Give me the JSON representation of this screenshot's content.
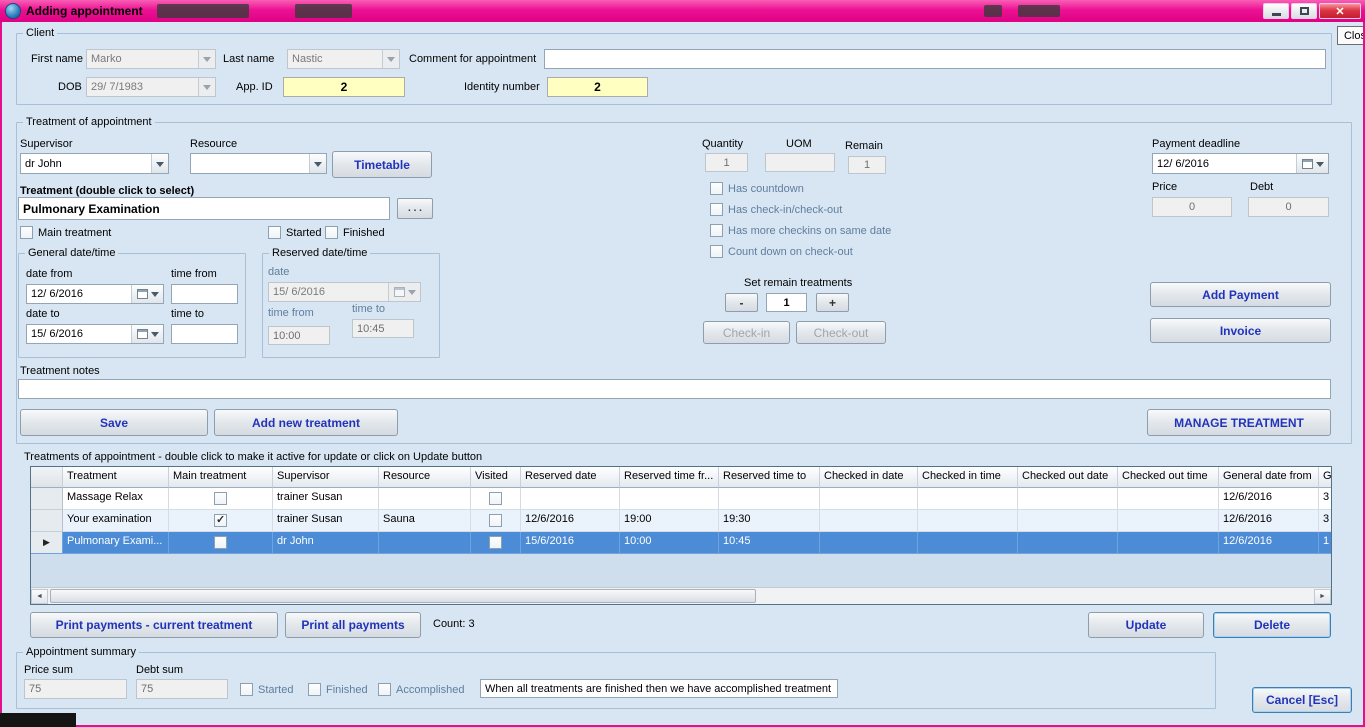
{
  "window": {
    "title": "Adding appointment",
    "close_button": "Close"
  },
  "client": {
    "label": "Client",
    "first_name": {
      "label": "First name",
      "value": "Marko"
    },
    "last_name": {
      "label": "Last name",
      "value": "Nastic"
    },
    "comment": {
      "label": "Comment for appointment",
      "value": ""
    },
    "dob": {
      "label": "DOB",
      "value": "29/ 7/1983"
    },
    "app_id": {
      "label": "App. ID",
      "value": "2"
    },
    "identity": {
      "label": "Identity number",
      "value": "2"
    }
  },
  "treatment": {
    "label": "Treatment of appointment",
    "supervisor": {
      "label": "Supervisor",
      "value": "dr John"
    },
    "resource": {
      "label": "Resource",
      "value": ""
    },
    "timetable": "Timetable",
    "select_label": "Treatment (double click to select)",
    "name": "Pulmonary Examination",
    "browse": ". . .",
    "main_cb": "Main treatment",
    "started_cb": "Started",
    "finished_cb": "Finished",
    "general": {
      "label": "General date/time",
      "date_from": {
        "label": "date from",
        "value": "12/ 6/2016"
      },
      "time_from": {
        "label": "time from",
        "value": ""
      },
      "date_to": {
        "label": "date to",
        "value": "15/ 6/2016"
      },
      "time_to": {
        "label": "time to",
        "value": ""
      }
    },
    "reserved": {
      "label": "Reserved date/time",
      "date": {
        "label": "date",
        "value": "15/ 6/2016"
      },
      "time_from": {
        "label": "time from",
        "value": "10:00"
      },
      "time_to": {
        "label": "time to",
        "value": "10:45"
      }
    },
    "quantity": {
      "label": "Quantity",
      "value": "1"
    },
    "uom": {
      "label": "UOM",
      "value": ""
    },
    "remain": {
      "label": "Remain",
      "value": "1"
    },
    "cbs": {
      "countdown": "Has countdown",
      "checkin": "Has check-in/check-out",
      "more": "Has more checkins on same date",
      "countdown_checkout": "Count down on check-out"
    },
    "set_remain": {
      "label": "Set remain treatments",
      "minus": "-",
      "value": "1",
      "plus": "+"
    },
    "checkin": "Check-in",
    "checkout": "Check-out",
    "payment_deadline": {
      "label": "Payment deadline",
      "value": "12/ 6/2016"
    },
    "price": {
      "label": "Price",
      "value": "0"
    },
    "debt": {
      "label": "Debt",
      "value": "0"
    },
    "add_payment": "Add Payment",
    "invoice": "Invoice",
    "notes": {
      "label": "Treatment notes",
      "value": ""
    },
    "save": "Save",
    "add_new": "Add new treatment",
    "manage": "MANAGE TREATMENT"
  },
  "grid": {
    "caption": "Treatments of appointment - double click to make it active for update or click on Update button",
    "columns": [
      "",
      "Treatment",
      "Main treatment",
      "Supervisor",
      "Resource",
      "Visited",
      "Reserved date",
      "Reserved time fr...",
      "Reserved time to",
      "Checked in date",
      "Checked in time",
      "Checked out date",
      "Checked out time",
      "General date from",
      "G"
    ],
    "row_indicator": "▶",
    "scroll_left": "◄",
    "scroll_right": "►",
    "rows": [
      {
        "treatment": "Massage Relax",
        "main_treatment": false,
        "supervisor": "trainer Susan",
        "resource": "",
        "visited": false,
        "reserved_date": "",
        "reserved_time_from": "",
        "reserved_time_to": "",
        "checked_in_date": "",
        "checked_in_time": "",
        "checked_out_date": "",
        "checked_out_time": "",
        "general_date_from": "12/6/2016",
        "clipped": "3",
        "selected": false
      },
      {
        "treatment": "Your examination",
        "main_treatment": true,
        "supervisor": "trainer Susan",
        "resource": "Sauna",
        "visited": false,
        "reserved_date": "12/6/2016",
        "reserved_time_from": "19:00",
        "reserved_time_to": "19:30",
        "checked_in_date": "",
        "checked_in_time": "",
        "checked_out_date": "",
        "checked_out_time": "",
        "general_date_from": "12/6/2016",
        "clipped": "3",
        "selected": false
      },
      {
        "treatment": "Pulmonary Exami...",
        "main_treatment": false,
        "supervisor": "dr John",
        "resource": "",
        "visited": false,
        "reserved_date": "15/6/2016",
        "reserved_time_from": "10:00",
        "reserved_time_to": "10:45",
        "checked_in_date": "",
        "checked_in_time": "",
        "checked_out_date": "",
        "checked_out_time": "",
        "general_date_from": "12/6/2016",
        "clipped": "1",
        "selected": true
      }
    ]
  },
  "actions": {
    "print_current": "Print payments - current treatment",
    "print_all": "Print all payments",
    "count": "Count: 3",
    "update": "Update",
    "delete": "Delete"
  },
  "summary": {
    "label": "Appointment summary",
    "price_sum": {
      "label": "Price sum",
      "value": "75"
    },
    "debt_sum": {
      "label": "Debt sum",
      "value": "75"
    },
    "started": "Started",
    "finished": "Finished",
    "accomplished": "Accomplished",
    "note": "When all treatments are finished then we have accomplished treatment",
    "cancel": "Cancel [Esc]"
  }
}
